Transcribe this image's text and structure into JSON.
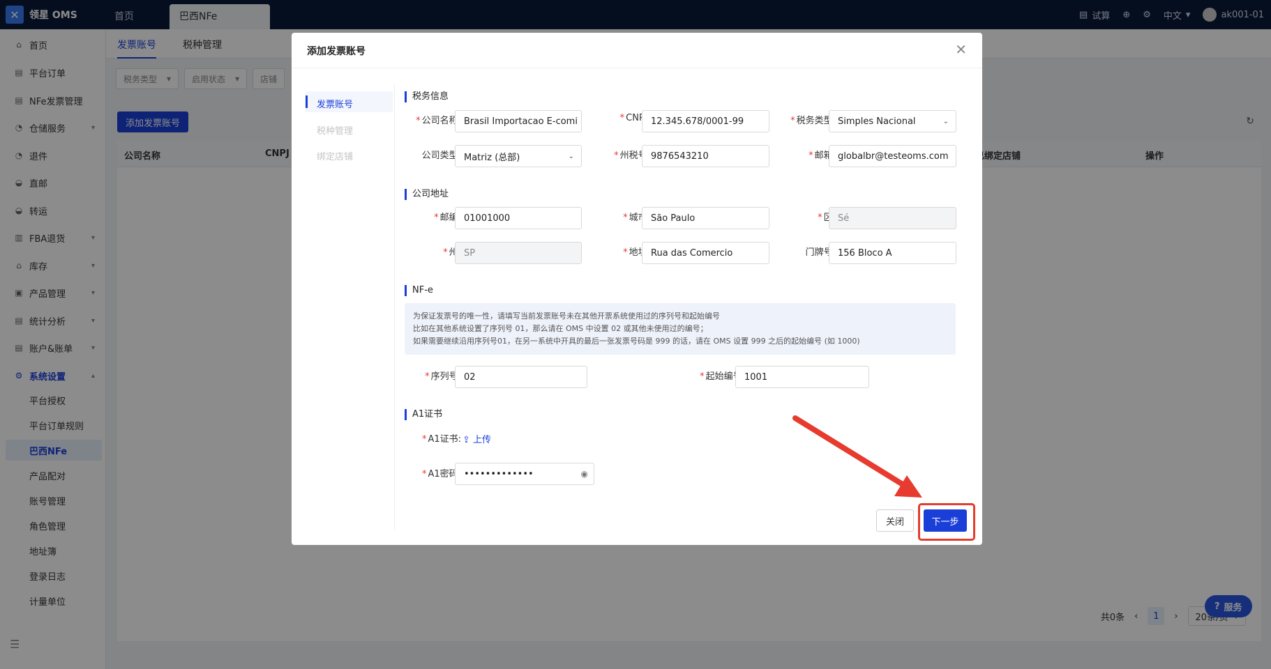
{
  "topbar": {
    "logo": "领星 OMS",
    "tabs": [
      "首页",
      "巴西NFe"
    ],
    "right": {
      "trial": "试算",
      "language": "中文",
      "user": "ak001-01"
    }
  },
  "sidebar": {
    "items": [
      {
        "label": "首页",
        "icon": "home-icon"
      },
      {
        "label": "平台订单",
        "icon": "order-icon"
      },
      {
        "label": "NFe发票管理",
        "icon": "invoice-icon"
      },
      {
        "label": "仓储服务",
        "icon": "warehouse-icon"
      },
      {
        "label": "退件",
        "icon": "return-icon"
      },
      {
        "label": "直邮",
        "icon": "mail-icon"
      },
      {
        "label": "转运",
        "icon": "transfer-icon"
      },
      {
        "label": "FBA退货",
        "icon": "fba-icon"
      },
      {
        "label": "库存",
        "icon": "inventory-icon"
      },
      {
        "label": "产品管理",
        "icon": "product-icon"
      },
      {
        "label": "统计分析",
        "icon": "stats-icon"
      },
      {
        "label": "账户&账单",
        "icon": "account-icon"
      },
      {
        "label": "系统设置",
        "icon": "settings-icon"
      }
    ],
    "subitems": [
      "平台授权",
      "平台订单规则",
      "巴西NFe",
      "产品配对",
      "账号管理",
      "角色管理",
      "地址簿",
      "登录日志",
      "计量单位"
    ]
  },
  "main": {
    "subtabs": [
      "发票账号",
      "税种管理"
    ],
    "filters": [
      "税务类型",
      "启用状态",
      "店铺"
    ],
    "add_button": "添加发票账号",
    "columns": [
      "公司名称",
      "CNPJ",
      "已绑定店铺",
      "操作"
    ],
    "pager": {
      "total": "共0条",
      "page": "1",
      "size": "20条/页"
    },
    "service": "服务"
  },
  "modal": {
    "title": "添加发票账号",
    "steps": [
      "发票账号",
      "税种管理",
      "绑定店铺"
    ],
    "tax_section": "税务信息",
    "labels": {
      "company_name": "公司名称:",
      "cnpj": "CNPJ:",
      "tax_type": "税务类型:",
      "company_type": "公司类型:",
      "state_tax": "州税号:",
      "email": "邮箱:",
      "zip": "邮编:",
      "city": "城市:",
      "district": "区:",
      "state": "州:",
      "address": "地址:",
      "number": "门牌号:",
      "serial": "序列号:",
      "start_no": "起始编号:",
      "a1_cert": "A1证书:",
      "a1_pwd": "A1密码:"
    },
    "values": {
      "company_name": "Brasil Importacao E-comi",
      "cnpj": "12.345.678/0001-99",
      "tax_type": "Simples Nacional",
      "company_type": "Matriz (总部)",
      "state_tax": "9876543210",
      "email": "globalbr@testeoms.com",
      "zip": "01001000",
      "city": "São Paulo",
      "district": "Sé",
      "state": "SP",
      "address": "Rua das Comercio",
      "number": "156 Bloco A",
      "serial": "02",
      "start_no": "1001",
      "a1_pwd": "•••••••••••••"
    },
    "address_section": "公司地址",
    "nfe_section": "NF-e",
    "notice": [
      "为保证发票号的唯一性，请填写当前发票账号未在其他开票系统使用过的序列号和起始编号",
      "比如在其他系统设置了序列号 01，那么请在 OMS 中设置 02 或其他未使用过的编号；",
      "如果需要继续沿用序列号01，在另一系统中开具的最后一张发票号码是 999 的话，请在 OMS 设置 999 之后的起始编号 (如 1000)"
    ],
    "a1_section": "A1证书",
    "upload": "上传",
    "close_button": "关闭",
    "next_button": "下一步"
  }
}
